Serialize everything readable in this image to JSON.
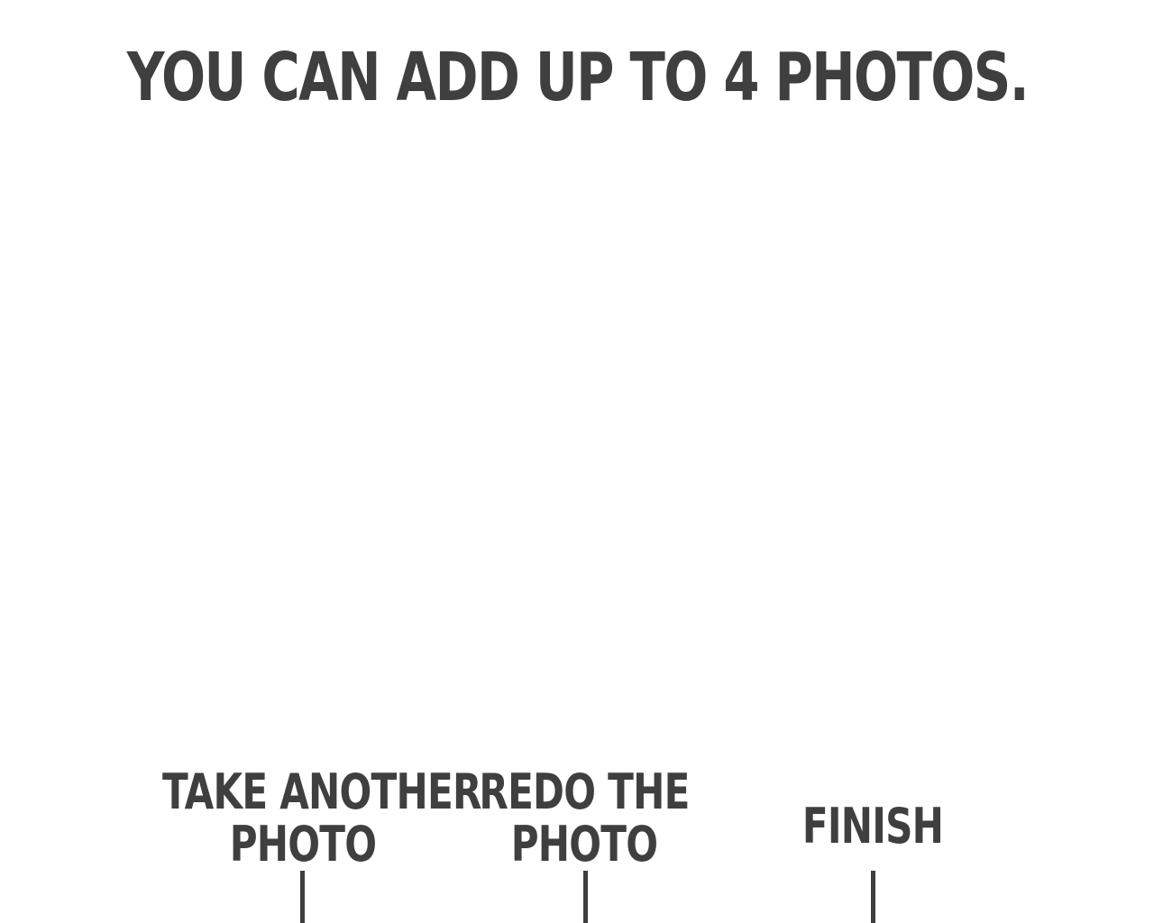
{
  "heading": "YOU CAN ADD UP TO 4 PHOTOS.",
  "actions": {
    "take_another": {
      "line1": "TAKE ANOTHER",
      "line2": "PHOTO"
    },
    "redo": {
      "line1": "REDO THE",
      "line2": "PHOTO"
    },
    "finish": {
      "label": "FINISH"
    }
  },
  "colors": {
    "text": "#3f3f3f",
    "background": "#ffffff"
  }
}
